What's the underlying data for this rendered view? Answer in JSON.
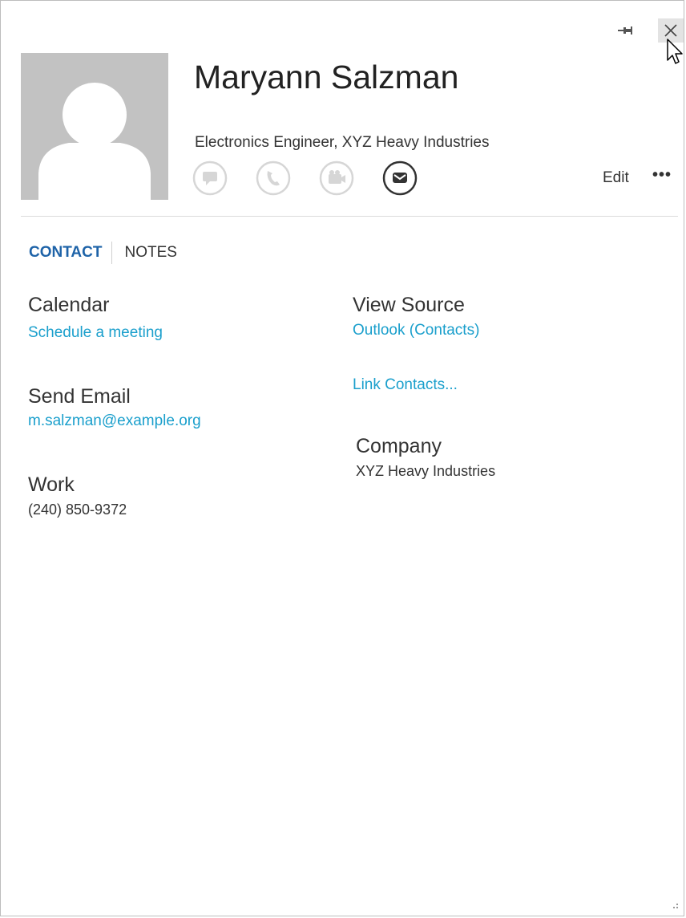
{
  "window": {
    "pin_icon": "pin-icon",
    "close_icon": "close-icon"
  },
  "header": {
    "name": "Maryann Salzman",
    "job_title": "Electronics Engineer, XYZ Heavy Industries",
    "edit_label": "Edit",
    "more_label": "•••",
    "actions": [
      {
        "icon": "chat-icon",
        "enabled": false
      },
      {
        "icon": "phone-icon",
        "enabled": false
      },
      {
        "icon": "video-icon",
        "enabled": false
      },
      {
        "icon": "email-icon",
        "enabled": true
      }
    ]
  },
  "tabs": [
    {
      "label": "CONTACT",
      "active": true
    },
    {
      "label": "NOTES",
      "active": false
    }
  ],
  "contact": {
    "calendar": {
      "label": "Calendar",
      "value": "Schedule a meeting"
    },
    "send_email": {
      "label": "Send Email",
      "value": "m.salzman@example.org"
    },
    "work": {
      "label": "Work",
      "value": "(240) 850-9372"
    },
    "view_source": {
      "label": "View Source",
      "value": "Outlook (Contacts)"
    },
    "link_contacts": {
      "value": "Link Contacts..."
    },
    "company": {
      "label": "Company",
      "value": "XYZ Heavy Industries"
    }
  },
  "colors": {
    "accent_link": "#1a9fcc",
    "active_tab": "#1e63a8",
    "avatar_bg": "#c2c2c2"
  }
}
